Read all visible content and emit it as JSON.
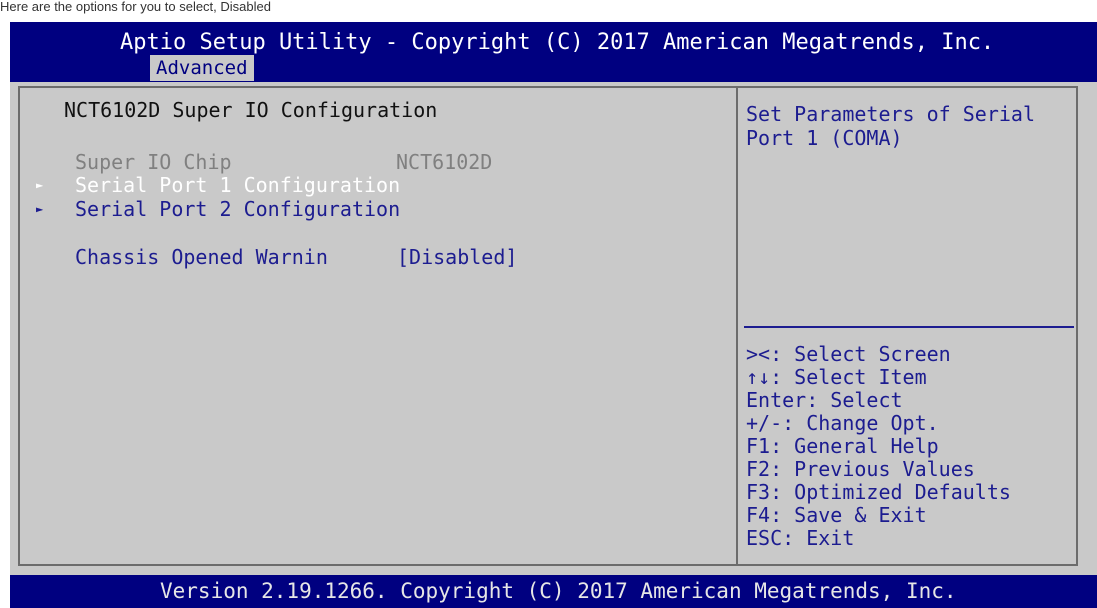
{
  "document_text": "Here are the options for you to select, Disabled",
  "title": "Aptio Setup Utility - Copyright (C) 2017 American Megatrends, Inc.",
  "active_tab": "Advanced",
  "page_title": "NCT6102D Super IO Configuration",
  "chip": {
    "label": "Super IO Chip",
    "value": "NCT6102D"
  },
  "menu": [
    {
      "label": "Serial Port 1 Configuration"
    },
    {
      "label": "Serial Port 2 Configuration"
    }
  ],
  "chassis": {
    "label": "Chassis Opened Warnin",
    "value": "[Disabled]"
  },
  "help_text": "Set Parameters of Serial Port 1 (COMA)",
  "keys": [
    "><: Select Screen",
    "↑↓: Select Item",
    "Enter: Select",
    "+/-: Change Opt.",
    "F1: General Help",
    "F2: Previous Values",
    "F3: Optimized Defaults",
    "F4: Save & Exit",
    "ESC: Exit"
  ],
  "footer": "Version 2.19.1266. Copyright (C) 2017 American Megatrends, Inc.",
  "colors": {
    "title_bar": "#000080",
    "panel_bg": "#c9c9c9",
    "text_blue": "#1c1c90",
    "selected_text": "#ffffff",
    "disabled_text": "#808080"
  }
}
